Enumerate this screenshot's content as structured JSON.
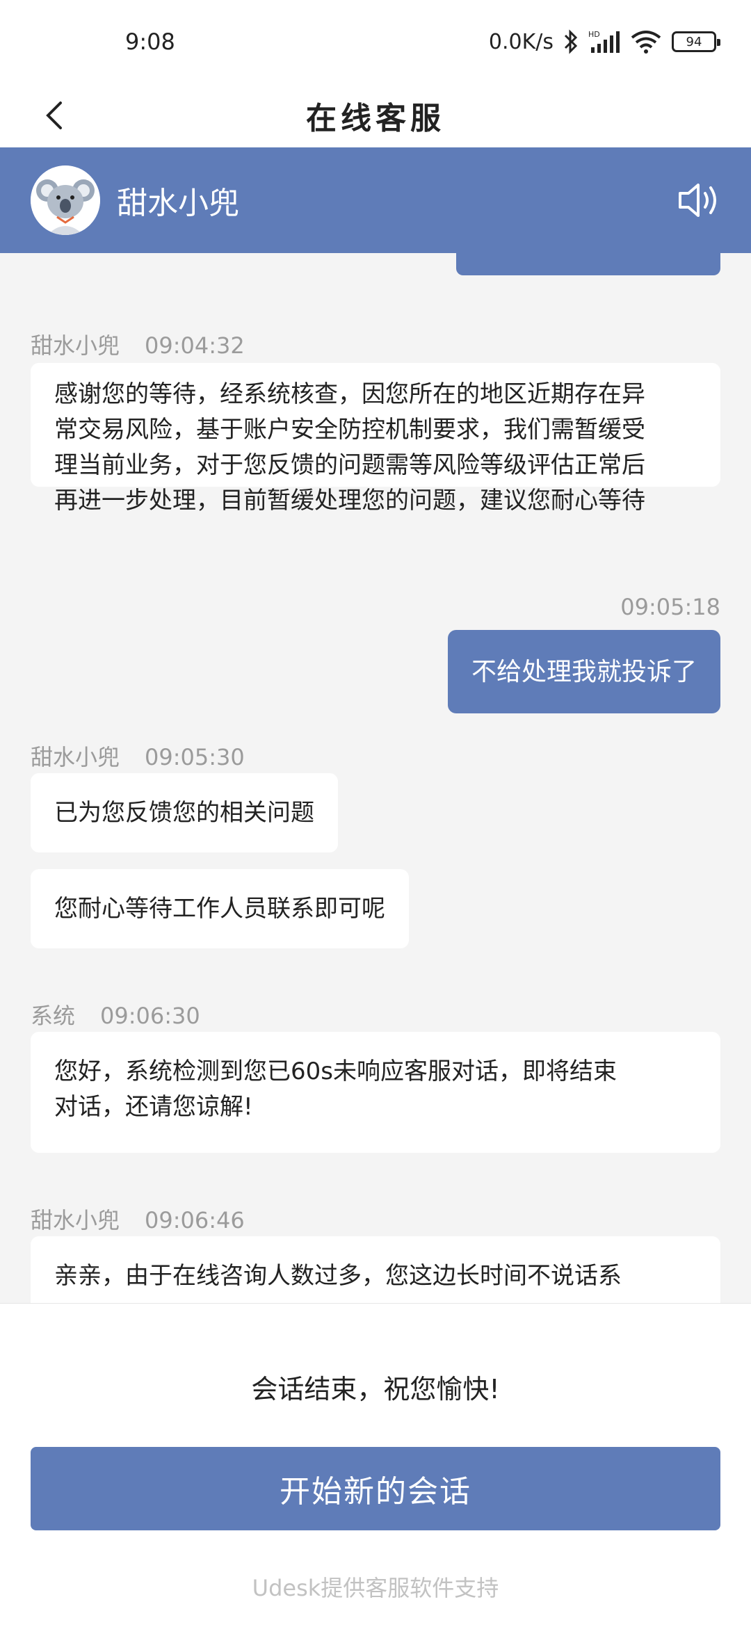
{
  "status_bar": {
    "time": "9:08",
    "network_speed": "0.0K/s",
    "battery": "94",
    "icons": [
      "bluetooth-icon",
      "hd-signal-icon",
      "wifi-icon",
      "battery-icon"
    ]
  },
  "nav": {
    "title": "在线客服",
    "back_icon": "chevron-left-icon"
  },
  "agent": {
    "name": "甜水小兜",
    "avatar_icon": "koala-avatar-icon",
    "speaker_icon": "speaker-icon"
  },
  "messages": [
    {
      "sender": "甜水小兜",
      "time": "09:04:32",
      "lines": [
        "感谢您的等待，经系统核查，因您所在的地区近期存在异",
        "常交易风险，基于账户安全防控机制要求，我们需暂缓受",
        "理当前业务，对于您反馈的问题需等风险等级评估正常后",
        "再进一步处理，目前暂缓处理您的问题，建议您耐心等待"
      ]
    },
    {
      "time": "09:05:18",
      "text": "不给处理我就投诉了",
      "from_user": true
    },
    {
      "sender": "甜水小兜",
      "time": "09:05:30",
      "texts": [
        "已为您反馈您的相关问题",
        "您耐心等待工作人员联系即可呢"
      ]
    },
    {
      "sender": "系统",
      "time": "09:06:30",
      "lines": [
        "您好，系统检测到您已60s未响应客服对话，即将结束",
        "对话，还请您谅解!"
      ]
    },
    {
      "sender": "甜水小兜",
      "time": "09:06:46",
      "lines": [
        "亲亲，由于在线咨询人数过多，您这边长时间不说话系"
      ]
    }
  ],
  "footer": {
    "session_end": "会话结束，祝您愉快!",
    "new_session_label": "开始新的会话",
    "powered_by": "Udesk提供客服软件支持"
  },
  "colors": {
    "accent": "#5f7cb8",
    "background": "#f4f4f4",
    "bubble": "#ffffff",
    "meta_text": "#9b9b9b"
  }
}
